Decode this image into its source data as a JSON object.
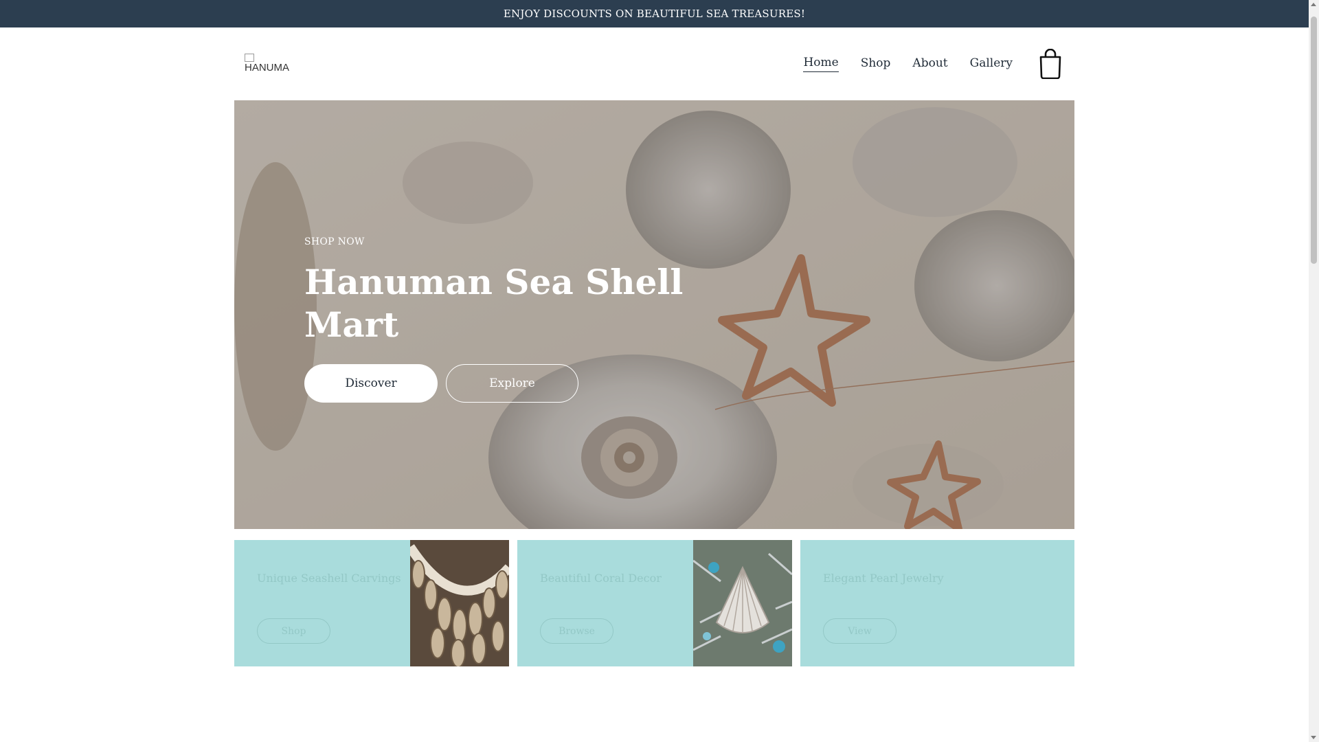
{
  "announcement": {
    "text": "ENJOY DISCOUNTS ON BEAUTIFUL SEA TREASURES!"
  },
  "header": {
    "logo_alt": "HANUMA",
    "nav": [
      {
        "label": "Home",
        "active": true
      },
      {
        "label": "Shop",
        "active": false
      },
      {
        "label": "About",
        "active": false
      },
      {
        "label": "Gallery",
        "active": false
      }
    ],
    "cart_icon": "shopping-bag-icon"
  },
  "hero": {
    "eyebrow": "SHOP NOW",
    "title": "Hanuman Sea Shell Mart",
    "primary_button": "Discover",
    "secondary_button": "Explore"
  },
  "cards": [
    {
      "title": "Unique Seashell Carvings",
      "button": "Shop"
    },
    {
      "title": "Beautiful Coral Decor",
      "button": "Browse"
    },
    {
      "title": "Elegant Pearl Jewelry",
      "button": "View"
    }
  ],
  "colors": {
    "announcement_bg": "#2c3e50",
    "card_bg": "#a9dcdc",
    "card_text": "#93c8c6"
  }
}
